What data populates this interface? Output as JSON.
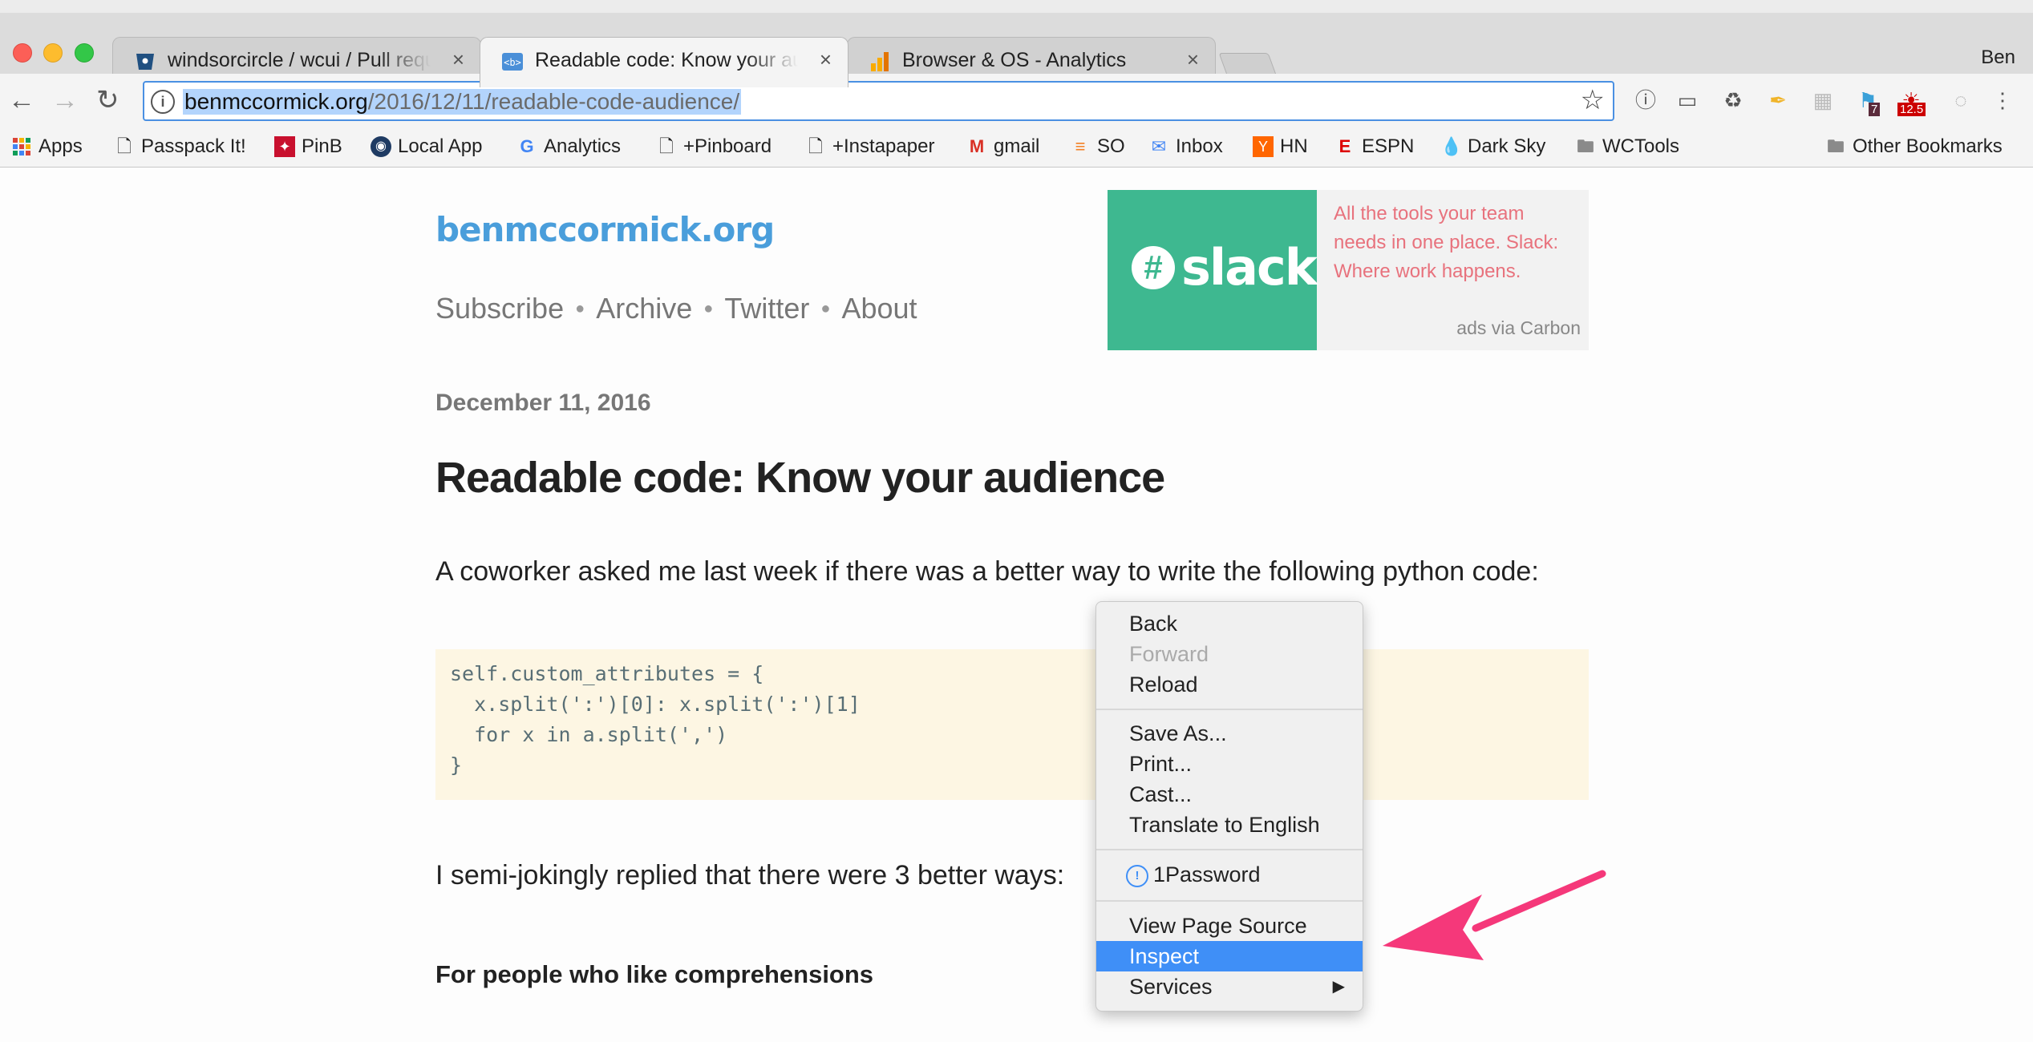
{
  "browser": {
    "tabs": [
      {
        "title": "windsorcircle / wcui / Pull requ",
        "icon": "bitbucket-icon"
      },
      {
        "title": "Readable code: Know your aud",
        "icon": "code-tag-icon"
      },
      {
        "title": "Browser & OS - Analytics",
        "icon": "analytics-icon"
      }
    ],
    "close_glyph": "×",
    "profile_name": "Ben",
    "url_host": "benmccormick.org",
    "url_path": "/2016/12/11/readable-code-audience/",
    "extension_badges": {
      "badge_a": "7",
      "badge_b": "12.5"
    }
  },
  "bookmarks": [
    {
      "label": "Apps",
      "icon": "apps-grid-icon"
    },
    {
      "label": "Passpack It!",
      "icon": "page-icon"
    },
    {
      "label": "PinB",
      "icon": "pin-icon"
    },
    {
      "label": "Local App",
      "icon": "local-app-icon"
    },
    {
      "label": "Analytics",
      "icon": "google-icon"
    },
    {
      "label": "+Pinboard",
      "icon": "page-icon"
    },
    {
      "label": "+Instapaper",
      "icon": "page-icon"
    },
    {
      "label": "gmail",
      "icon": "gmail-icon"
    },
    {
      "label": "SO",
      "icon": "stackoverflow-icon"
    },
    {
      "label": "Inbox",
      "icon": "inbox-icon"
    },
    {
      "label": "HN",
      "icon": "hn-icon"
    },
    {
      "label": "ESPN",
      "icon": "espn-icon"
    },
    {
      "label": "Dark Sky",
      "icon": "darksky-icon"
    },
    {
      "label": "WCTools",
      "icon": "folder-icon"
    }
  ],
  "other_bookmarks": "Other Bookmarks",
  "page": {
    "site_title": "benmccormick.org",
    "nav": [
      "Subscribe",
      "Archive",
      "Twitter",
      "About"
    ],
    "ad": {
      "brand": "slack",
      "text": "All the tools your team needs in one place. Slack: Where work happens.",
      "via": "ads via Carbon"
    },
    "date": "December 11, 2016",
    "heading": "Readable code: Know your audience",
    "intro": "A coworker asked me last week if there was a better way to write the following python code:",
    "code_lines": [
      "self.custom_attributes = {",
      "  x.split(':')[0]: x.split(':')[1]",
      "  for x in a.split(',')",
      "}"
    ],
    "reply": "I semi-jokingly replied that there were 3 better ways:",
    "subheading": "For people who like comprehensions"
  },
  "context_menu": {
    "items": [
      "Back",
      "Forward",
      "Reload",
      "Save As...",
      "Print...",
      "Cast...",
      "Translate to English",
      "1Password",
      "View Page Source",
      "Inspect",
      "Services"
    ],
    "disabled": [
      "Forward"
    ],
    "selected": "Inspect"
  },
  "colors": {
    "link_blue": "#4a9edb",
    "menu_highlight": "#3f8ff7",
    "annotation_arrow": "#f5387a",
    "slack_green": "#3eb890",
    "ad_text": "#e8727d"
  }
}
